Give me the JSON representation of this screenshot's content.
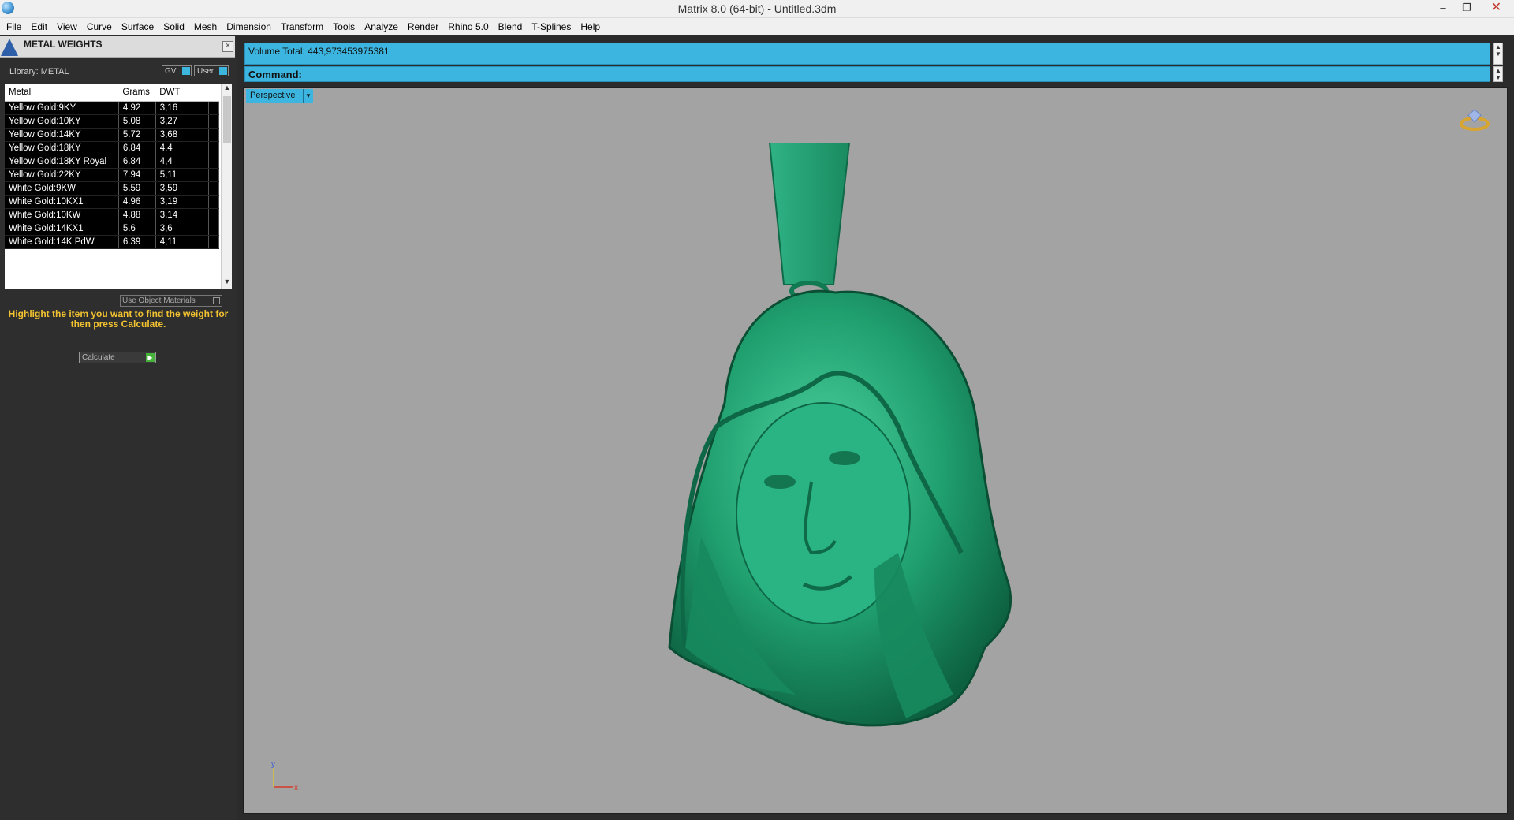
{
  "window": {
    "title": "Matrix 8.0 (64-bit) - Untitled.3dm",
    "icon": "matrix-globe-icon"
  },
  "menu": [
    "File",
    "Edit",
    "View",
    "Curve",
    "Surface",
    "Solid",
    "Mesh",
    "Dimension",
    "Transform",
    "Tools",
    "Analyze",
    "Render",
    "Rhino 5.0",
    "Blend",
    "T-Splines",
    "Help"
  ],
  "panel": {
    "title": "METAL WEIGHTS",
    "library_label": "Library: METAL",
    "gv_label": "GV",
    "user_label": "User",
    "columns": [
      "Metal",
      "Grams",
      "DWT"
    ],
    "rows": [
      [
        "Yellow Gold:9KY",
        "4.92",
        "3,16"
      ],
      [
        "Yellow Gold:10KY",
        "5.08",
        "3,27"
      ],
      [
        "Yellow Gold:14KY",
        "5.72",
        "3,68"
      ],
      [
        "Yellow Gold:18KY",
        "6.84",
        "4,4"
      ],
      [
        "Yellow Gold:18KY Royal",
        "6.84",
        "4,4"
      ],
      [
        "Yellow Gold:22KY",
        "7.94",
        "5,11"
      ],
      [
        "White Gold:9KW",
        "5.59",
        "3,59"
      ],
      [
        "White Gold:10KX1",
        "4.96",
        "3,19"
      ],
      [
        "White Gold:10KW",
        "4.88",
        "3,14"
      ],
      [
        "White Gold:14KX1",
        "5.6",
        "3,6"
      ],
      [
        "White Gold:14K PdW",
        "6.39",
        "4,11"
      ]
    ],
    "use_object_materials": "Use Object Materials",
    "instruction": "Highlight the item you want to find the weight for then press Calculate.",
    "calculate_label": "Calculate"
  },
  "command": {
    "volume_text": "Volume Total: 443,973453975381",
    "command_label": "Command:"
  },
  "viewport": {
    "name": "Perspective",
    "axis_y": "y",
    "axis_x": "x"
  },
  "colors": {
    "accent": "#3cb6e0",
    "model": "#1f9e6e",
    "viewport_bg": "#a3a3a3",
    "instruction": "#f2c230"
  }
}
